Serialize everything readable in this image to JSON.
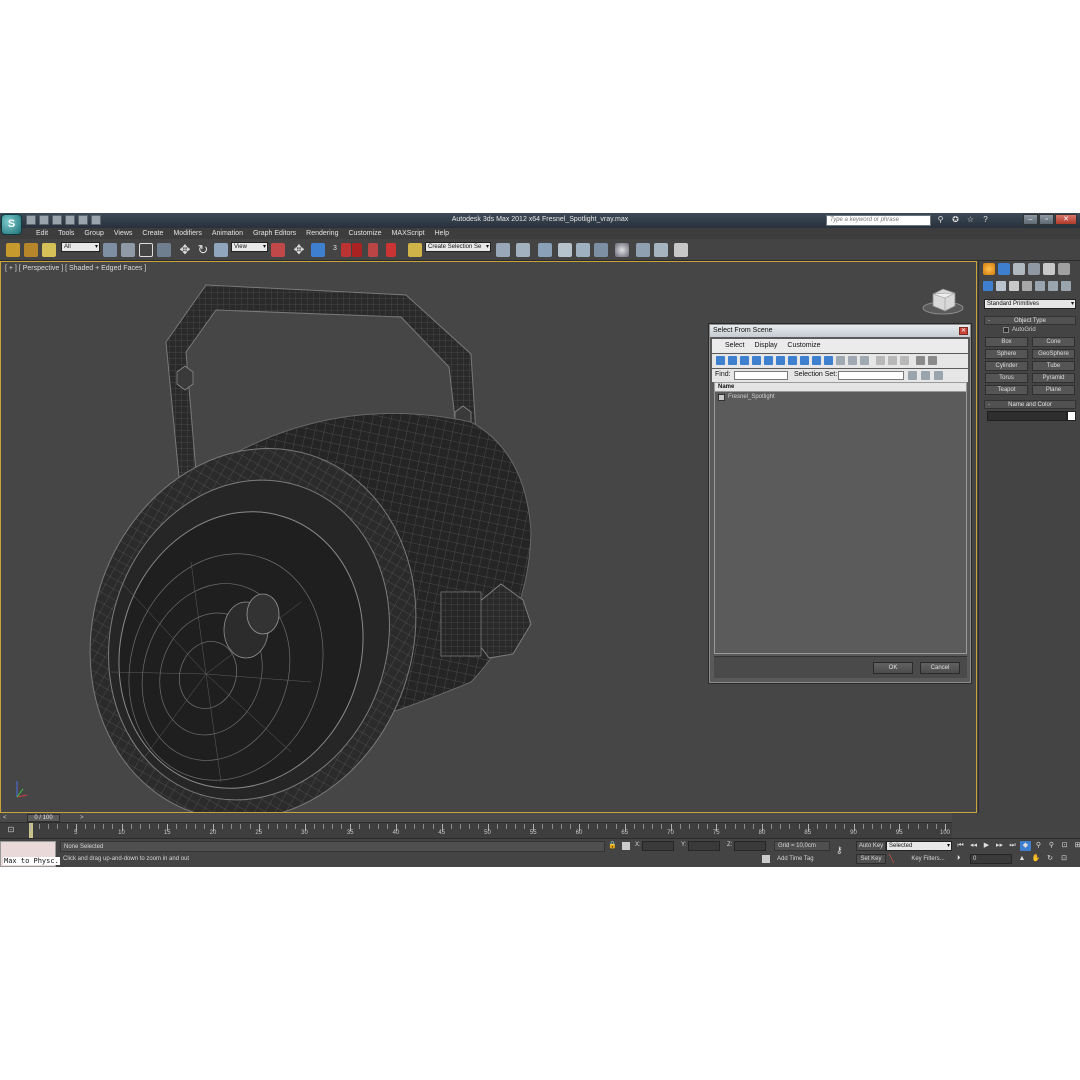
{
  "window": {
    "title": "Autodesk 3ds Max  2012 x64    Fresnel_Spotlight_vray.max",
    "search_placeholder": "Type a keyword or phrase",
    "logo": "3ds-max-logo",
    "icons": [
      "binoculars-icon",
      "star-icon",
      "help-icon"
    ]
  },
  "menu": [
    "Edit",
    "Tools",
    "Group",
    "Views",
    "Create",
    "Modifiers",
    "Animation",
    "Graph Editors",
    "Rendering",
    "Customize",
    "MAXScript",
    "Help"
  ],
  "toolbar": {
    "selection_filter": "All",
    "reference_coord": "View",
    "named_selection_sets": "Create Selection Se",
    "snap_value": "3"
  },
  "viewport": {
    "label": "[ + ] [ Perspective ] [ Shaded + Edged Faces ]"
  },
  "dialog": {
    "title": "Select From Scene",
    "menu": [
      "Select",
      "Display",
      "Customize"
    ],
    "find_label": "Find:",
    "find_value": "",
    "selection_set_label": "Selection Set:",
    "selection_set_value": "",
    "column_header": "Name",
    "rows": [
      "Fresnel_Spotlight"
    ],
    "ok_label": "OK",
    "cancel_label": "Cancel"
  },
  "command_panel": {
    "category": "Standard Primitives",
    "object_type_title": "Object Type",
    "autogrid_label": "AutoGrid",
    "autogrid_checked": false,
    "object_buttons": [
      "Box",
      "Cone",
      "Sphere",
      "GeoSphere",
      "Cylinder",
      "Tube",
      "Torus",
      "Pyramid",
      "Teapot",
      "Plane"
    ],
    "name_and_color_title": "Name and Color",
    "object_color": "#ffffff"
  },
  "timeline": {
    "frame_display": "0 / 100",
    "ticks": [
      5,
      10,
      15,
      20,
      25,
      30,
      35,
      40,
      45,
      50,
      55,
      60,
      65,
      70,
      75,
      80,
      85,
      90,
      95,
      100
    ],
    "prev_arrow": "<",
    "next_arrow": ">"
  },
  "status": {
    "maxscript_text": "Max to Physc.",
    "selection_status": "None Selected",
    "prompt": "Click and drag up-and-down to zoom in and out",
    "x_label": "X:",
    "y_label": "Y:",
    "z_label": "Z:",
    "grid": "Grid = 10,0cm",
    "add_time_tag": "Add Time Tag",
    "auto_key": "Auto Key",
    "set_key": "Set Key",
    "key_mode": "Selected",
    "key_filters": "Key Filters...",
    "current_frame": "0"
  },
  "colors": {
    "viewport_border": "#c8a43c",
    "accent_blue": "#3f7fd0",
    "app_background": "#444444"
  }
}
